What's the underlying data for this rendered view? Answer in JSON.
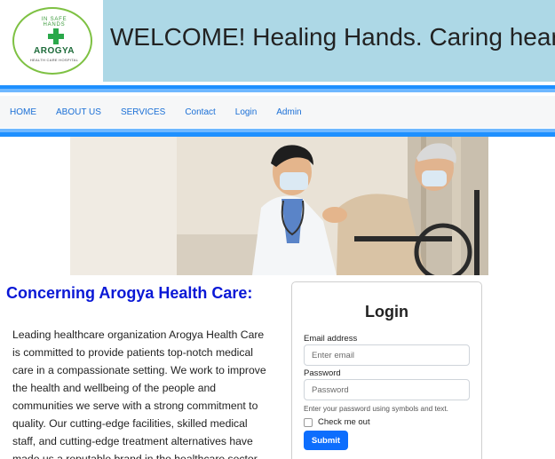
{
  "header": {
    "logo": {
      "tagline": "IN SAFE HANDS",
      "name": "AROGYA",
      "subtitle": "HEALTH CARE HOSPITAL"
    },
    "banner_title": "WELCOME! Healing Hands. Caring hearts",
    "colors": {
      "banner": "#add8e6",
      "logo_green": "#2aa84a",
      "stripe": "#1e90ff"
    }
  },
  "nav": {
    "items": [
      {
        "label": "HOME"
      },
      {
        "label": "ABOUT US"
      },
      {
        "label": "SERVICES"
      },
      {
        "label": "Contact"
      },
      {
        "label": "Login"
      },
      {
        "label": "Admin"
      }
    ]
  },
  "hero": {
    "icon": "doctor-patient-photo"
  },
  "about": {
    "title": "Concerning Arogya Health Care:",
    "text": "Leading healthcare organization Arogya Health Care is committed to provide patients top-notch medical care in a compassionate setting. We work to improve the health and wellbeing of the people and communities we serve with a strong commitment to quality. Our cutting-edge facilities, skilled medical staff, and cutting-edge treatment alternatives have made us a reputable brand in the healthcare sector."
  },
  "login": {
    "title": "Login",
    "email_label": "Email address",
    "email_placeholder": "Enter email",
    "password_label": "Password",
    "password_placeholder": "Password",
    "help_text": "Enter your password using symbols and text.",
    "check_label": "Check me out",
    "submit_label": "Submit"
  }
}
